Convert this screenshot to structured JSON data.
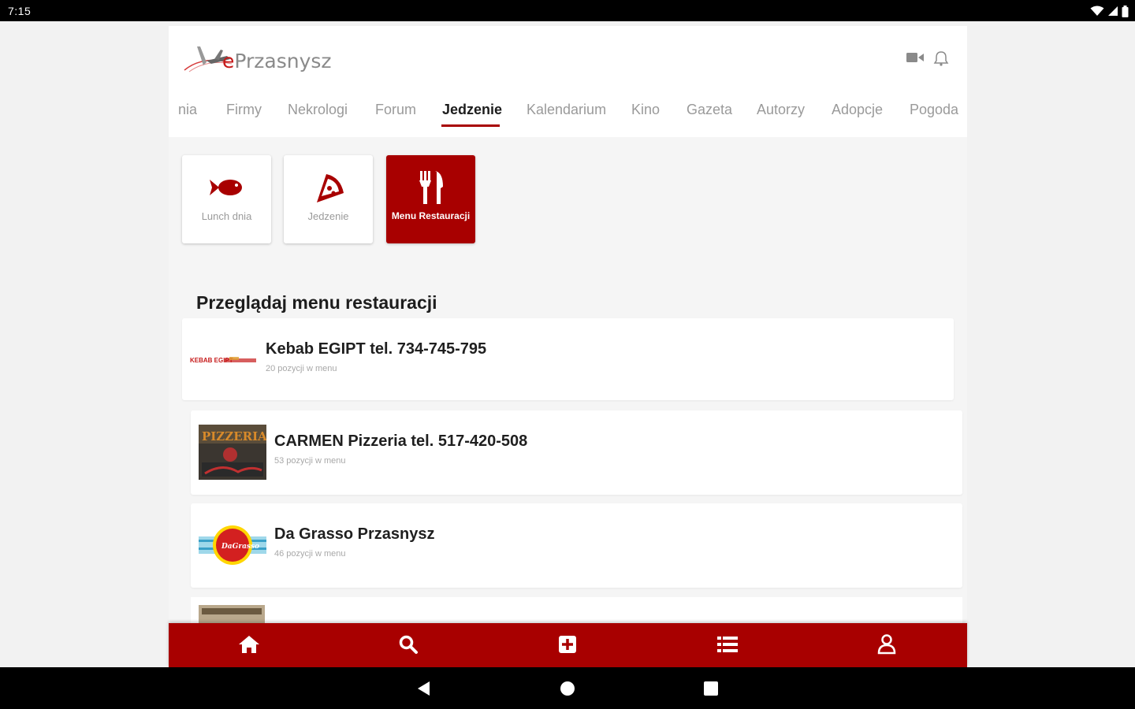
{
  "status_bar": {
    "time": "7:15"
  },
  "app": {
    "logo_text_prefix": "e",
    "logo_text_rest": "Przasnysz"
  },
  "nav": {
    "items": [
      {
        "label": "nia",
        "active": false
      },
      {
        "label": "Firmy",
        "active": false
      },
      {
        "label": "Nekrologi",
        "active": false
      },
      {
        "label": "Forum",
        "active": false
      },
      {
        "label": "Jedzenie",
        "active": true
      },
      {
        "label": "Kalendarium",
        "active": false
      },
      {
        "label": "Kino",
        "active": false
      },
      {
        "label": "Gazeta",
        "active": false
      },
      {
        "label": "Autorzy",
        "active": false
      },
      {
        "label": "Adopcje",
        "active": false
      },
      {
        "label": "Pogoda",
        "active": false
      }
    ]
  },
  "categories": [
    {
      "label": "Lunch dnia",
      "icon": "fish-icon",
      "active": false
    },
    {
      "label": "Jedzenie",
      "icon": "pizza-icon",
      "active": false
    },
    {
      "label": "Menu Restauracji",
      "icon": "fork-knife-icon",
      "active": true
    }
  ],
  "section": {
    "title": "Przeglądaj menu restauracji"
  },
  "restaurants": [
    {
      "name": "Kebab EGIPT tel. 734-745-795",
      "count": "20 pozycji w menu",
      "thumb_text": "KEBAB EGIPT"
    },
    {
      "name": "CARMEN Pizzeria tel. 517-420-508",
      "count": "53 pozycji w menu",
      "thumb_text": "PIZZERIA Carmen"
    },
    {
      "name": "Da Grasso Przasnysz",
      "count": "46 pozycji w menu",
      "thumb_text": "DaGrasso"
    }
  ],
  "bottom_nav": [
    {
      "name": "home-icon"
    },
    {
      "name": "search-icon"
    },
    {
      "name": "add-box-icon"
    },
    {
      "name": "list-icon"
    },
    {
      "name": "user-icon"
    }
  ],
  "colors": {
    "brand": "#a80000",
    "logo_red": "#c61a1a",
    "muted_text": "#9a9a9a"
  }
}
